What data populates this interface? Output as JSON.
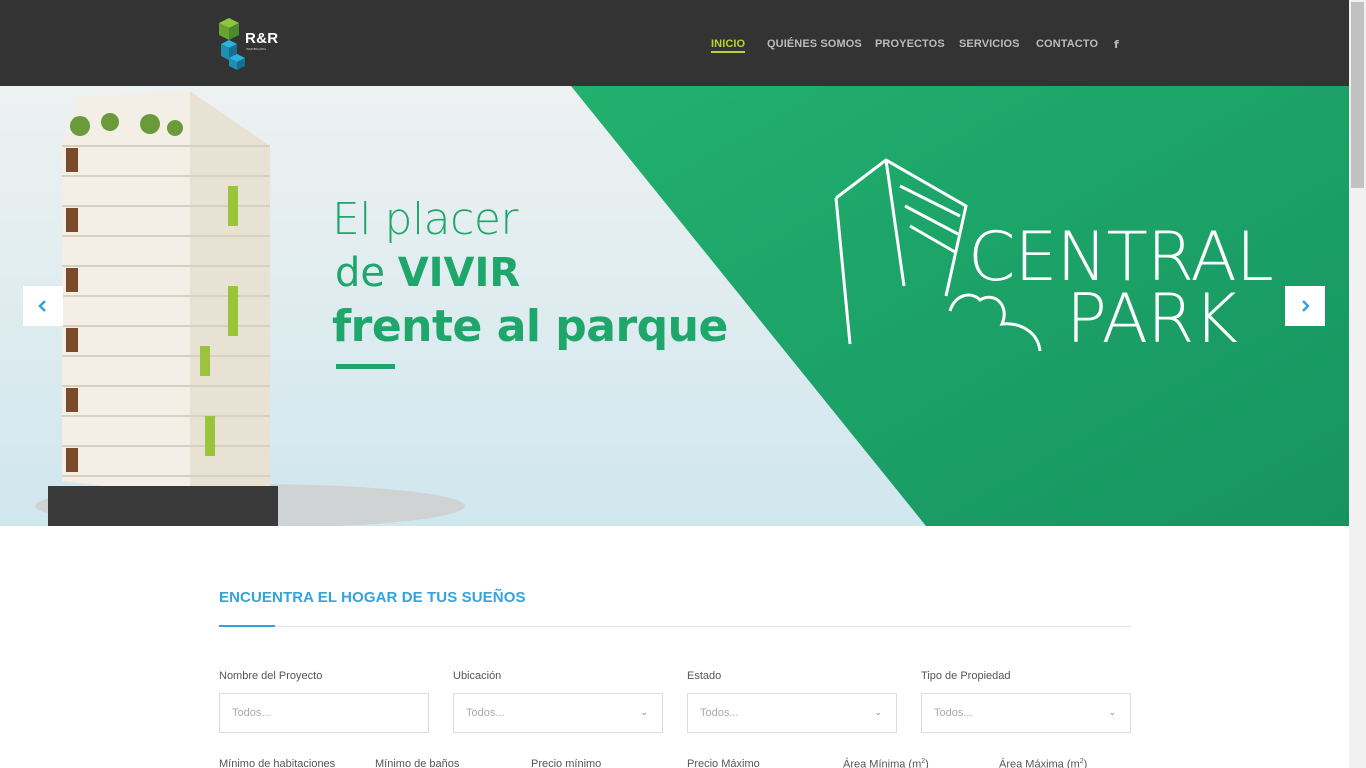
{
  "brand": {
    "logo_text": "R&R",
    "logo_sub": "INMOBILIARIA"
  },
  "nav": {
    "items": [
      "INICIO",
      "QUIÉNES SOMOS",
      "PROYECTOS",
      "SERVICIOS",
      "CONTACTO"
    ],
    "active": "INICIO",
    "facebook": "f"
  },
  "slide": {
    "headline_line1": "El placer",
    "headline_line2_prefix": "de ",
    "headline_line2_bold": "VIVIR",
    "headline_line3": "frente al parque",
    "brand_line1": "CENTRAL",
    "brand_line2": "PARK",
    "prev_icon": "chevron-left-icon",
    "next_icon": "chevron-right-icon"
  },
  "colors": {
    "header_bg": "#333333",
    "nav_active": "#b5d334",
    "slide_green": "#1fa66a",
    "search_title": "#33a3dc"
  },
  "search": {
    "title": "ENCUENTRA EL HOGAR DE TUS SUEÑOS",
    "fields": [
      {
        "label": "Nombre del Proyecto",
        "placeholder": "Todos...",
        "type": "text"
      },
      {
        "label": "Ubicación",
        "placeholder": "Todos...",
        "type": "select"
      },
      {
        "label": "Estado",
        "placeholder": "Todos...",
        "type": "select"
      },
      {
        "label": "Tipo de Propiedad",
        "placeholder": "Todos...",
        "type": "select"
      }
    ],
    "row2_labels": {
      "min_rooms": "Mínimo de habitaciones",
      "min_baths": "Mínimo de baños",
      "min_price": "Precio mínimo",
      "max_price": "Precio Máximo",
      "min_area": "Área Mínima (m",
      "max_area": "Área Máxima (m",
      "area_sup": "2",
      "area_close": ")"
    }
  }
}
